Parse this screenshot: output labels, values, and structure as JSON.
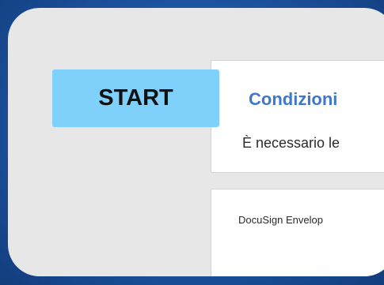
{
  "start_button": {
    "label": "START"
  },
  "agreement": {
    "title": "Condizioni",
    "subtitle": "È necessario le"
  },
  "document": {
    "envelope_text": "DocuSign Envelop"
  },
  "colors": {
    "start_button_bg": "#7fd0fb",
    "title_color": "#3f78c9",
    "background_blue": "#1d54a0"
  }
}
